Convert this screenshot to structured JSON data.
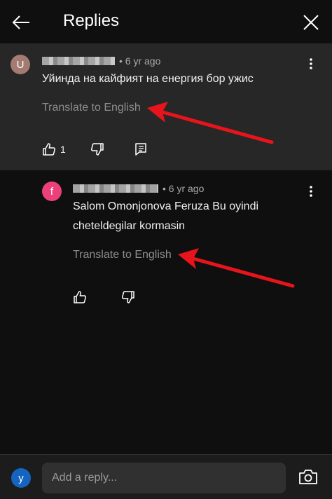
{
  "header": {
    "title": "Replies"
  },
  "comments": [
    {
      "avatar_letter": "U",
      "avatar_color": "#a47b72",
      "time": "• 6 yr ago",
      "text": "Уйинда на кайфият на енергия бор ужис",
      "translate_label": "Translate to English",
      "like_count": "1"
    },
    {
      "avatar_letter": "f",
      "avatar_color": "#ec407a",
      "time": "• 6 yr ago",
      "text_line1": "Salom Omonjonova Feruza Bu oyindi",
      "text_line2": "cheteldegilar kormasin",
      "translate_label": "Translate to English"
    }
  ],
  "reply_bar": {
    "avatar_letter": "y",
    "avatar_color": "#1565c0",
    "placeholder": "Add a reply..."
  },
  "colors": {
    "annotation_arrow": "#e8141b",
    "highlight_bg": "#272727"
  },
  "icons": [
    "back-arrow-icon",
    "close-icon",
    "more-vert-icon",
    "thumb-up-icon",
    "thumb-down-icon",
    "comment-icon",
    "camera-icon"
  ]
}
